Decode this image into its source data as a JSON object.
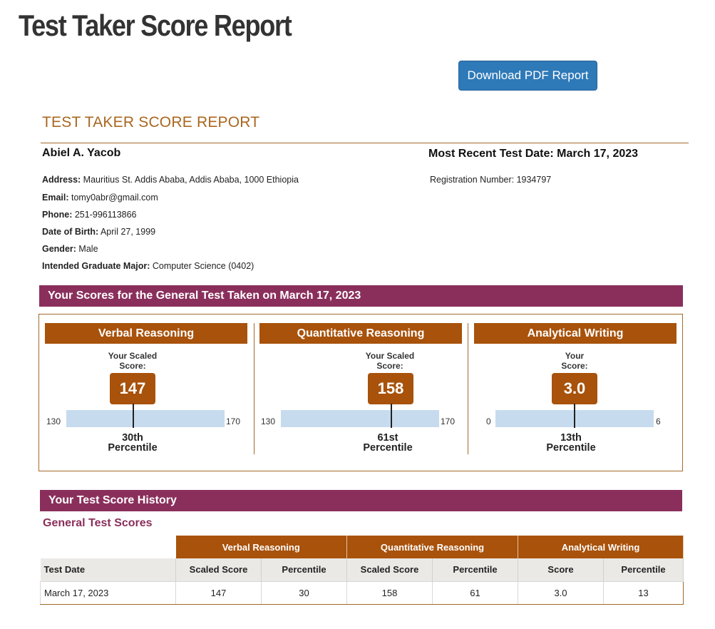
{
  "page_title": "Test Taker Score Report",
  "download_button": "Download PDF Report",
  "report_heading": "TEST TAKER SCORE REPORT",
  "taker": {
    "name": "Abiel A. Yacob",
    "most_recent_test_date": "Most Recent Test Date: March 17, 2023",
    "registration": "Registration Number: 1934797",
    "fields": [
      {
        "label": "Address:",
        "value": "Mauritius St. Addis Ababa, Addis Ababa, 1000 Ethiopia"
      },
      {
        "label": "Email:",
        "value": "tomy0abr@gmail.com"
      },
      {
        "label": "Phone:",
        "value": "251-996113866"
      },
      {
        "label": "Date of Birth:",
        "value": "April 27, 1999"
      },
      {
        "label": "Gender:",
        "value": "Male"
      },
      {
        "label": "Intended Graduate Major:",
        "value": "Computer Science (0402)"
      }
    ]
  },
  "scores_band": "Your Scores for the General Test Taken on March 17, 2023",
  "sections": [
    {
      "title": "Verbal Reasoning",
      "score_label_1": "Your Scaled",
      "score_label_2": "Score:",
      "score": "147",
      "score_num": 147,
      "min": "130",
      "max": "170",
      "min_num": 130,
      "max_num": 170,
      "percentile_num": "30th",
      "percentile_word": "Percentile"
    },
    {
      "title": "Quantitative Reasoning",
      "score_label_1": "Your Scaled",
      "score_label_2": "Score:",
      "score": "158",
      "score_num": 158,
      "min": "130",
      "max": "170",
      "min_num": 130,
      "max_num": 170,
      "percentile_num": "61st",
      "percentile_word": "Percentile"
    },
    {
      "title": "Analytical Writing",
      "score_label_1": "Your",
      "score_label_2": "Score:",
      "score": "3.0",
      "score_num": 3.0,
      "min": "0",
      "max": "6",
      "min_num": 0,
      "max_num": 6,
      "percentile_num": "13th",
      "percentile_word": "Percentile"
    }
  ],
  "history_band": "Your Test Score History",
  "history_sub": "General Test Scores",
  "history_table": {
    "groups": [
      "Verbal Reasoning",
      "Quantitative Reasoning",
      "Analytical Writing"
    ],
    "headers": [
      "Test Date",
      "Scaled Score",
      "Percentile",
      "Scaled Score",
      "Percentile",
      "Score",
      "Percentile"
    ],
    "rows": [
      [
        "March 17, 2023",
        "147",
        "30",
        "158",
        "61",
        "3.0",
        "13"
      ]
    ]
  },
  "colors": {
    "band": "#8a2f5c",
    "section_header": "#a8520b",
    "button": "#2e79b8",
    "heading": "#a9661f",
    "bar": "#c7dbee"
  }
}
